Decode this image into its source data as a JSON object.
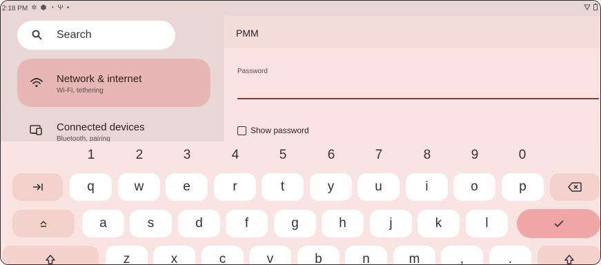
{
  "status_bar": {
    "time": "2:18 PM",
    "icons": [
      "settings-icon",
      "shield-icon",
      "wifi-icon",
      "usb-icon",
      "dot-icon",
      "wifi-signal-icon",
      "battery-icon"
    ]
  },
  "search": {
    "placeholder": "Search"
  },
  "sidebar": {
    "items": [
      {
        "title": "Network & internet",
        "subtitle": "Wi-Fi, tethering",
        "icon": "wifi-icon"
      },
      {
        "title": "Connected devices",
        "subtitle": "Bluetooth, pairing",
        "icon": "devices-icon"
      }
    ]
  },
  "dialog": {
    "network_name": "PMM",
    "password_label": "Password",
    "password_value": "",
    "show_password_label": "Show password",
    "show_password_checked": false
  },
  "keyboard": {
    "numbers": [
      "1",
      "2",
      "3",
      "4",
      "5",
      "6",
      "7",
      "8",
      "9",
      "0"
    ],
    "row1": [
      "q",
      "w",
      "e",
      "r",
      "t",
      "y",
      "u",
      "i",
      "o",
      "p"
    ],
    "row2": [
      "a",
      "s",
      "d",
      "f",
      "g",
      "h",
      "j",
      "k",
      "l"
    ],
    "row3": [
      "z",
      "x",
      "c",
      "v",
      "b",
      "n",
      "m",
      ",",
      "."
    ],
    "func_icons": {
      "tab": "tab-icon",
      "backspace": "backspace-icon",
      "caps": "caps-lock-icon",
      "enter": "checkmark-icon",
      "shift": "shift-icon"
    }
  },
  "colors": {
    "accent": "#8f3b35",
    "selected_nav": "#e6b7b4",
    "enter_key": "#f0a6a2"
  }
}
